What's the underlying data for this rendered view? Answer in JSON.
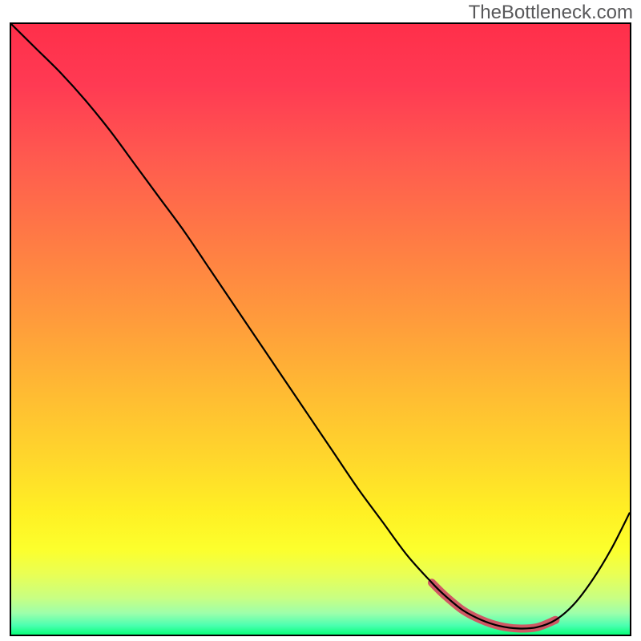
{
  "watermark": "TheBottleneck.com",
  "colors": {
    "highlight": "#cf5864",
    "curve": "#000000",
    "frame": "#000000",
    "gradient_top": "#ff2f4a",
    "gradient_bottom": "#08ff7a"
  },
  "chart_data": {
    "type": "line",
    "title": "",
    "xlabel": "",
    "ylabel": "",
    "xlim": [
      0,
      100
    ],
    "ylim": [
      0,
      100
    ],
    "grid": false,
    "legend": false,
    "series": [
      {
        "name": "curve",
        "x": [
          0,
          4,
          8,
          12,
          16,
          20,
          24,
          28,
          32,
          36,
          40,
          44,
          48,
          52,
          56,
          60,
          64,
          68,
          70,
          73,
          76,
          79,
          82,
          85,
          88,
          91,
          94,
          97,
          100
        ],
        "y": [
          100,
          96,
          92,
          87.5,
          82.5,
          77,
          71.5,
          66,
          60,
          54,
          48,
          42,
          36,
          30,
          24,
          18.5,
          13,
          8.5,
          6.5,
          4,
          2.4,
          1.4,
          1.0,
          1.2,
          2.4,
          5,
          9,
          14,
          20
        ]
      },
      {
        "name": "highlight",
        "x": [
          68,
          70,
          73,
          76,
          79,
          82,
          85,
          88
        ],
        "y": [
          8.5,
          6.5,
          4,
          2.4,
          1.4,
          1.0,
          1.2,
          2.4
        ]
      }
    ],
    "annotations": []
  }
}
